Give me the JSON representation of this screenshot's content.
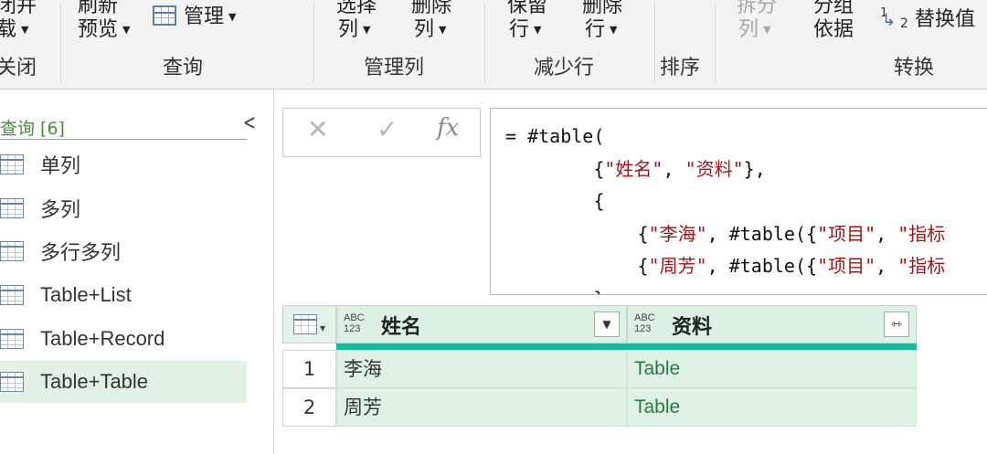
{
  "ribbon": {
    "buttons": {
      "close_load_line1": "闭并",
      "close_load_line2": "载",
      "refresh_line1": "刷新",
      "refresh_line2": "预览",
      "manage": "管理",
      "choose_columns_line1": "选择",
      "choose_columns_line2": "列",
      "remove_columns_line1": "删除",
      "remove_columns_line2": "列",
      "keep_rows_line1": "保留",
      "keep_rows_line2": "行",
      "remove_rows_line1": "删除",
      "remove_rows_line2": "行",
      "split_column_line1": "拆分",
      "split_column_line2": "列",
      "group_by_line1": "分组",
      "group_by_line2": "依据",
      "replace_values": "替换值"
    },
    "groups": {
      "close": "关闭",
      "query": "查询",
      "manage_columns": "管理列",
      "reduce_rows": "减少行",
      "sort": "排序",
      "transform": "转换"
    },
    "replace_icon": {
      "num1": "1",
      "num2": "2"
    }
  },
  "queries": {
    "header": "查询 [6]",
    "items": [
      {
        "label": "单列",
        "selected": false
      },
      {
        "label": "多列",
        "selected": false
      },
      {
        "label": "多行多列",
        "selected": false
      },
      {
        "label": "Table+List",
        "selected": false
      },
      {
        "label": "Table+Record",
        "selected": false
      },
      {
        "label": "Table+Table",
        "selected": true
      }
    ]
  },
  "formula": {
    "cancel_glyph": "✕",
    "commit_glyph": "✓",
    "fx_label": "fx",
    "lines": [
      {
        "pre": "= #table(",
        "parts": []
      },
      {
        "pre": "        {",
        "parts": [
          [
            "s",
            "\"姓名\""
          ],
          [
            "t",
            ", "
          ],
          [
            "s",
            "\"资料\""
          ],
          [
            "t",
            "},"
          ]
        ]
      },
      {
        "pre": "        {",
        "parts": []
      },
      {
        "pre": "            {",
        "parts": [
          [
            "s",
            "\"李海\""
          ],
          [
            "t",
            ", #table({"
          ],
          [
            "s",
            "\"项目\""
          ],
          [
            "t",
            ", "
          ],
          [
            "s",
            "\"指标"
          ]
        ]
      },
      {
        "pre": "            {",
        "parts": [
          [
            "s",
            "\"周芳\""
          ],
          [
            "t",
            ", #table({"
          ],
          [
            "s",
            "\"项目\""
          ],
          [
            "t",
            ", "
          ],
          [
            "s",
            "\"指标"
          ]
        ]
      },
      {
        "pre": "        },",
        "parts": []
      }
    ]
  },
  "grid": {
    "columns": [
      {
        "type_top": "ABC",
        "type_bottom": "123",
        "name": "姓名"
      },
      {
        "type_top": "ABC",
        "type_bottom": "123",
        "name": "资料"
      }
    ],
    "rows": [
      {
        "num": "1",
        "cells": [
          "李海",
          "Table"
        ]
      },
      {
        "num": "2",
        "cells": [
          "周芳",
          "Table"
        ]
      }
    ]
  },
  "colors": {
    "accent_green": "#1fb79a",
    "selected_bg": "#e1f1e6",
    "header_bg": "#dbf1e4",
    "string_red": "#a31515"
  }
}
